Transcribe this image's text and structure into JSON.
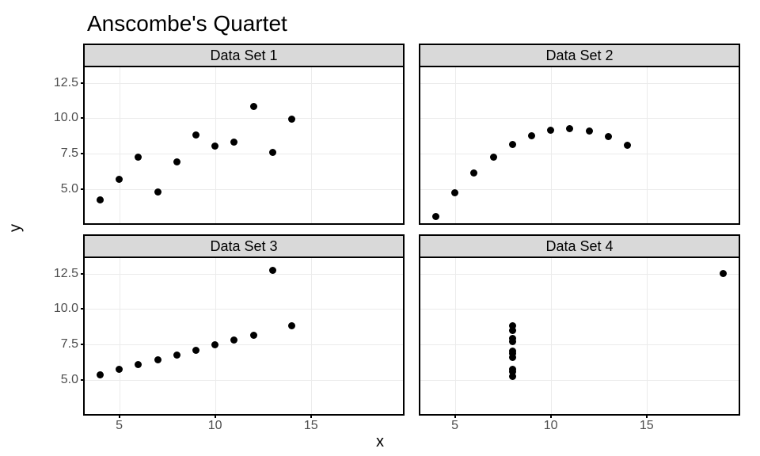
{
  "title": "Anscombe's Quartet",
  "xlab": "x",
  "ylab": "y",
  "xlim": [
    3.2,
    19.8
  ],
  "ylim": [
    2.6,
    13.6
  ],
  "xticks": [
    5,
    10,
    15
  ],
  "yticks": [
    5.0,
    7.5,
    10.0,
    12.5
  ],
  "xtick_labels": [
    "5",
    "10",
    "15"
  ],
  "ytick_labels": [
    "5.0",
    "7.5",
    "10.0",
    "12.5"
  ],
  "chart_data": [
    {
      "type": "scatter",
      "name": "Data Set 1",
      "x": [
        10,
        8,
        13,
        9,
        11,
        14,
        6,
        4,
        12,
        7,
        5
      ],
      "y": [
        8.04,
        6.95,
        7.58,
        8.81,
        8.33,
        9.96,
        7.24,
        4.26,
        10.84,
        4.82,
        5.68
      ]
    },
    {
      "type": "scatter",
      "name": "Data Set 2",
      "x": [
        10,
        8,
        13,
        9,
        11,
        14,
        6,
        4,
        12,
        7,
        5
      ],
      "y": [
        9.14,
        8.14,
        8.74,
        8.77,
        9.26,
        8.1,
        6.13,
        3.1,
        9.13,
        7.26,
        4.74
      ]
    },
    {
      "type": "scatter",
      "name": "Data Set 3",
      "x": [
        10,
        8,
        13,
        9,
        11,
        14,
        6,
        4,
        12,
        7,
        5
      ],
      "y": [
        7.46,
        6.77,
        12.74,
        7.11,
        7.81,
        8.84,
        6.08,
        5.39,
        8.15,
        6.42,
        5.73
      ]
    },
    {
      "type": "scatter",
      "name": "Data Set 4",
      "x": [
        8,
        8,
        8,
        8,
        8,
        8,
        8,
        19,
        8,
        8,
        8
      ],
      "y": [
        6.58,
        5.76,
        7.71,
        8.84,
        8.47,
        7.04,
        5.25,
        12.5,
        5.56,
        7.91,
        6.89
      ]
    }
  ]
}
